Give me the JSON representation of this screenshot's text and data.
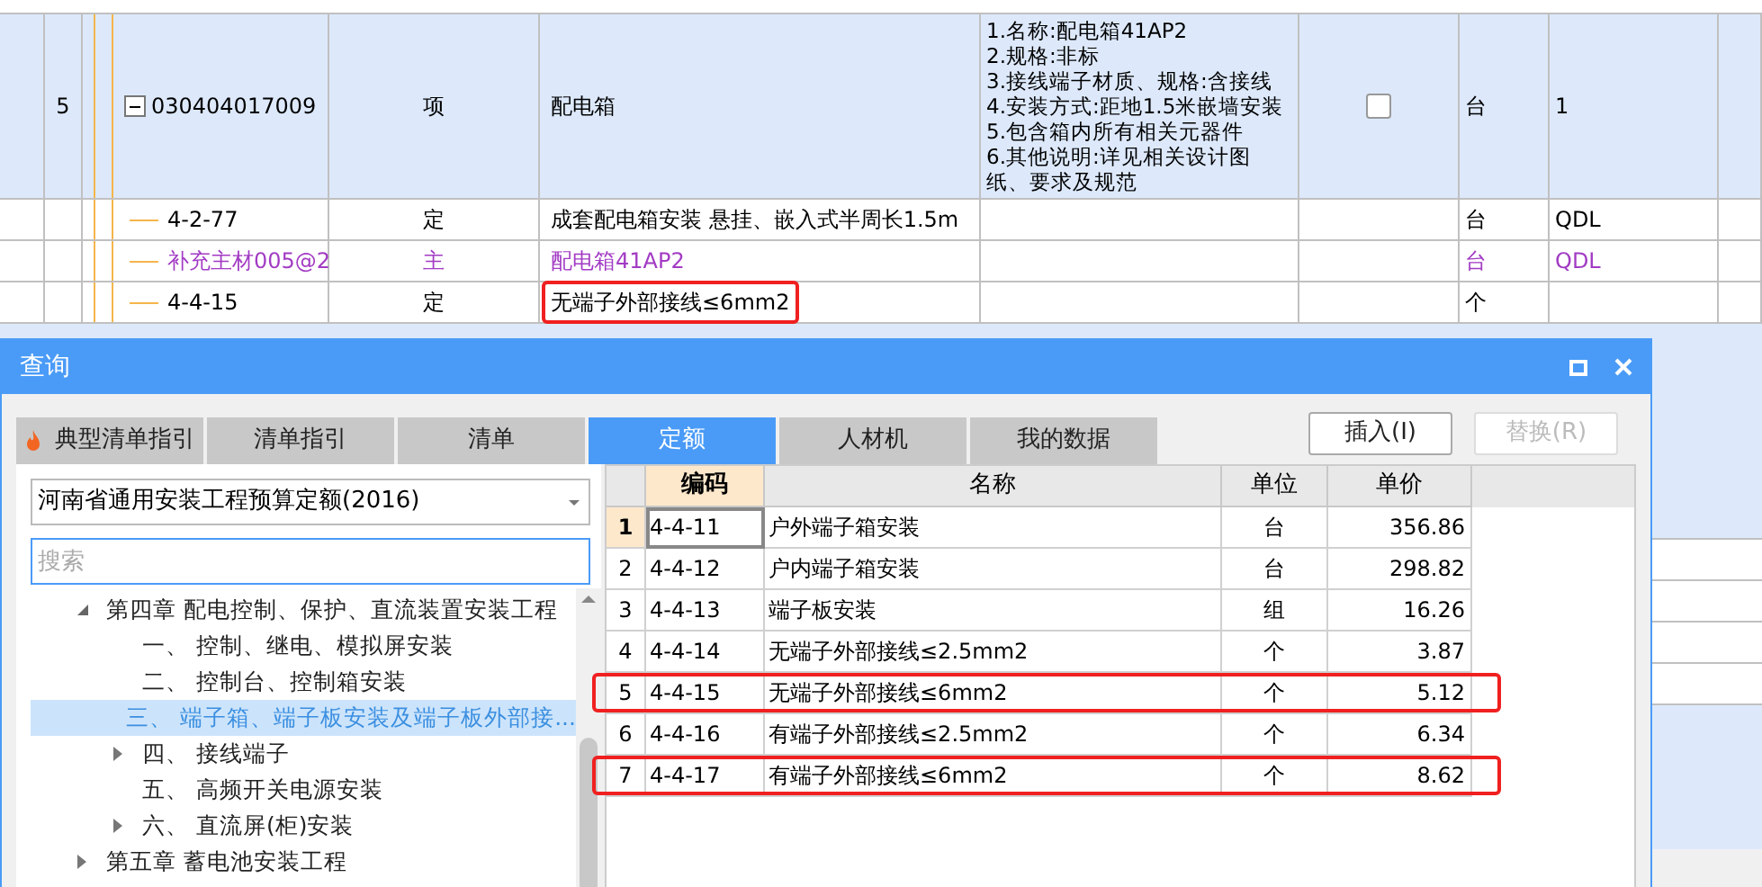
{
  "bg_table": {
    "rows": [
      {
        "number": "5",
        "kind": "item",
        "expanded": true,
        "code": "030404017009",
        "type": "项",
        "name": "配电箱",
        "features": [
          "1.名称:配电箱41AP2",
          "2.规格:非标",
          "3.接线端子材质、规格:含接线",
          "4.安装方式:距地1.5米嵌墙安装",
          "5.包含箱内所有相关元器件",
          "6.其他说明:详见相关设计图",
          "纸、要求及规范"
        ],
        "checked": false,
        "unit": "台",
        "quantity": "1",
        "highlighted": false
      },
      {
        "kind": "quota",
        "code": "4-2-77",
        "type": "定",
        "name": "成套配电箱安装 悬挂、嵌入式半周长1.5m",
        "unit": "台",
        "quantity": "QDL",
        "highlighted": false
      },
      {
        "kind": "material",
        "code": "补充主材005@2",
        "type": "主",
        "name": "配电箱41AP2",
        "unit": "台",
        "quantity": "QDL",
        "highlighted": false
      },
      {
        "kind": "quota",
        "code": "4-4-15",
        "type": "定",
        "name": "无端子外部接线≤6mm2",
        "unit": "个",
        "highlighted": true
      }
    ]
  },
  "dialog": {
    "title": "查询",
    "tabs": [
      {
        "label": "典型清单指引",
        "selected": false,
        "hot": true
      },
      {
        "label": "清单指引",
        "selected": false,
        "hot": false
      },
      {
        "label": "清单",
        "selected": false,
        "hot": false
      },
      {
        "label": "定额",
        "selected": true,
        "hot": false
      },
      {
        "label": "人材机",
        "selected": false,
        "hot": false
      },
      {
        "label": "我的数据",
        "selected": false,
        "hot": false
      }
    ],
    "buttons": [
      {
        "label": "插入(I)",
        "disabled": false
      },
      {
        "label": "替换(R)",
        "disabled": true
      }
    ],
    "library": {
      "value": "河南省通用安装工程预算定额(2016)"
    },
    "search": {
      "placeholder": "搜索"
    },
    "tree": [
      {
        "label": "第四章 配电控制、保护、直流装置安装工程",
        "expanded": true,
        "selected": false,
        "children": [
          {
            "label": "一、 控制、继电、模拟屏安装",
            "selected": false
          },
          {
            "label": "二、 控制台、控制箱安装",
            "selected": false
          },
          {
            "label": "三、 端子箱、端子板安装及端子板外部接...",
            "selected": true
          },
          {
            "label": "四、 接线端子",
            "expanded": false,
            "selected": false
          },
          {
            "label": "五、 高频开关电源安装",
            "selected": false
          },
          {
            "label": "六、 直流屏(柜)安装",
            "expanded": false,
            "selected": false
          }
        ]
      },
      {
        "label": "第五章 蓄电池安装工程",
        "expanded": false,
        "selected": false
      }
    ],
    "grid": {
      "columns": [
        "编码",
        "名称",
        "单位",
        "单价"
      ],
      "rows": [
        {
          "number": "1",
          "code": "4-4-11",
          "name": "户外端子箱安装",
          "unit": "台",
          "price": "356.86",
          "selected": true,
          "highlighted": false
        },
        {
          "number": "2",
          "code": "4-4-12",
          "name": "户内端子箱安装",
          "unit": "台",
          "price": "298.82",
          "selected": false,
          "highlighted": false
        },
        {
          "number": "3",
          "code": "4-4-13",
          "name": "端子板安装",
          "unit": "组",
          "price": "16.26",
          "selected": false,
          "highlighted": false
        },
        {
          "number": "4",
          "code": "4-4-14",
          "name": "无端子外部接线≤2.5mm2",
          "unit": "个",
          "price": "3.87",
          "selected": false,
          "highlighted": false
        },
        {
          "number": "5",
          "code": "4-4-15",
          "name": "无端子外部接线≤6mm2",
          "unit": "个",
          "price": "5.12",
          "selected": false,
          "highlighted": true
        },
        {
          "number": "6",
          "code": "4-4-16",
          "name": "有端子外部接线≤2.5mm2",
          "unit": "个",
          "price": "6.34",
          "selected": false,
          "highlighted": false
        },
        {
          "number": "7",
          "code": "4-4-17",
          "name": "有端子外部接线≤6mm2",
          "unit": "个",
          "price": "8.62",
          "selected": false,
          "highlighted": true
        }
      ]
    }
  }
}
